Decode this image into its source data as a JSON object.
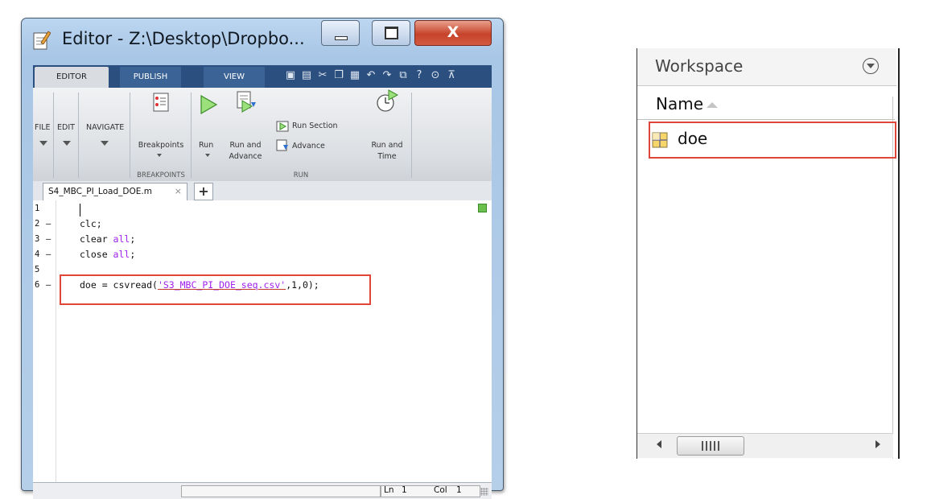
{
  "editor": {
    "title": "Editor - Z:\\Desktop\\Dropbo...",
    "close_glyph": "X",
    "tabs": {
      "editor": "EDITOR",
      "publish": "PUBLISH",
      "view": "VIEW"
    },
    "ribbon": {
      "file": "FILE",
      "edit": "EDIT",
      "navigate": "NAVIGATE",
      "breakpoints": "Breakpoints",
      "breakpoints_caption": "BREAKPOINTS",
      "run": "Run",
      "run_and_advance_l1": "Run and",
      "run_and_advance_l2": "Advance",
      "run_section": "Run Section",
      "advance": "Advance",
      "run_and_time_l1": "Run and",
      "run_and_time_l2": "Time",
      "run_caption": "RUN"
    },
    "file_tab": {
      "name": "S4_MBC_PI_Load_DOE.m",
      "close": "×",
      "add": "+"
    },
    "code": {
      "line_numbers": [
        "1",
        "2",
        "3",
        "4",
        "5",
        "6"
      ],
      "line2_cmd": "clc;",
      "line3_cmd": "clear ",
      "line3_arg": "all",
      "line3_end": ";",
      "line4_cmd": "close ",
      "line4_arg": "all",
      "line4_end": ";",
      "line6_lhs": "doe = csvread(",
      "line6_str": "'S3_MBC_PI_DOE_seq.csv'",
      "line6_rest": ",1,0);"
    },
    "status": {
      "ln_label": "Ln",
      "ln_value": "1",
      "col_label": "Col",
      "col_value": "1"
    }
  },
  "workspace": {
    "title": "Workspace",
    "column_name": "Name",
    "variables": [
      {
        "name": "doe"
      }
    ]
  },
  "colors": {
    "highlight": "#e0453a",
    "keyword": "#a020f0",
    "toolstrip": "#2b4f7e"
  }
}
